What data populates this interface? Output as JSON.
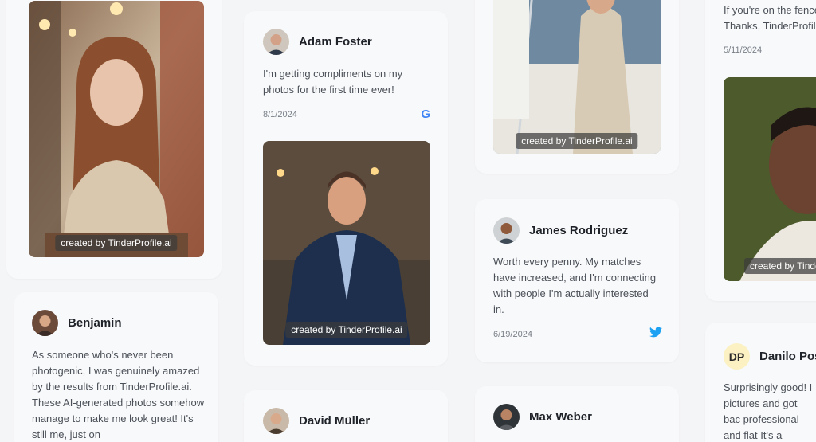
{
  "watermark": "created by TinderProfile.ai",
  "testimonials": {
    "adam": {
      "name": "Adam Foster",
      "text": "I'm getting compliments on my photos for the first time ever!",
      "date": "8/1/2024",
      "source_icon": "google-icon"
    },
    "benjamin": {
      "name": "Benjamin",
      "text": "As someone who's never been photogenic, I was genuinely amazed by the results from TinderProfile.ai. These AI-generated photos somehow manage to make me look great! It's still me, just on"
    },
    "david": {
      "name": "David Müller"
    },
    "james": {
      "name": "James Rodriguez",
      "text": "Worth every penny. My matches have increased, and I'm connecting with people I'm actually interested in.",
      "date": "6/19/2024",
      "source_icon": "twitter-icon"
    },
    "max": {
      "name": "Max Weber"
    },
    "partial_top": {
      "text": "If you're on the fence, Thanks, TinderProfile",
      "date": "5/11/2024"
    },
    "danilo": {
      "initials": "DP",
      "name": "Danilo Pos",
      "text": "Surprisingly good! I pictures and got bac professional and flat It's a practical servic"
    }
  },
  "colors": {
    "accent_twitter": "#1da1f2",
    "card_bg": "#f8f9fa",
    "page_bg": "#f4f5f7"
  }
}
